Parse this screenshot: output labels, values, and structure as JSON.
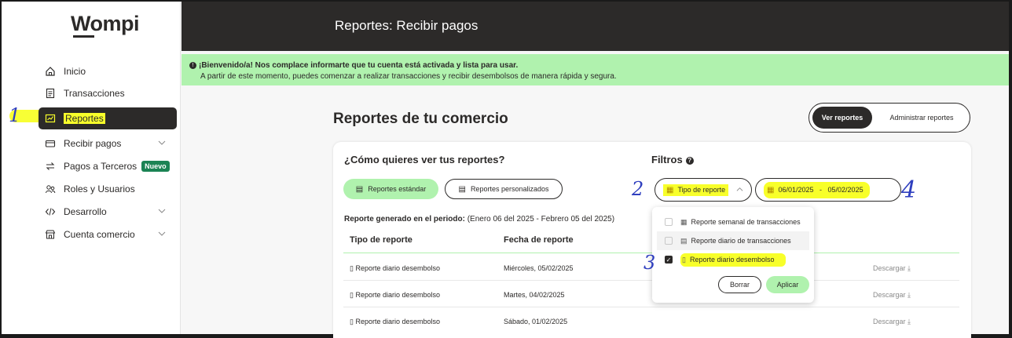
{
  "app": {
    "logo": "Wompi"
  },
  "sidebar": {
    "items": [
      {
        "label": "Inicio",
        "icon": "home-icon"
      },
      {
        "label": "Transacciones",
        "icon": "receipt-icon"
      },
      {
        "label": "Reportes",
        "icon": "report-icon",
        "active": true
      },
      {
        "label": "Recibir pagos",
        "icon": "card-icon",
        "expandable": true
      },
      {
        "label": "Pagos a Terceros",
        "icon": "transfer-icon",
        "badge": "Nuevo"
      },
      {
        "label": "Roles y Usuarios",
        "icon": "users-icon"
      },
      {
        "label": "Desarrollo",
        "icon": "code-icon",
        "expandable": true
      },
      {
        "label": "Cuenta comercio",
        "icon": "store-icon",
        "expandable": true
      }
    ]
  },
  "annotations": {
    "n1": "1",
    "n2": "2",
    "n3": "3",
    "n4": "4",
    "highlight_color": "#f8ff2a",
    "ink_color": "#2f3fbf"
  },
  "header": {
    "title": "Reportes: Recibir pagos"
  },
  "banner": {
    "line1": "¡Bienvenido/a! Nos complace informarte que tu cuenta está activada y lista para usar.",
    "line2": "A partir de este momento, puedes comenzar a realizar transacciones y recibir desembolsos de manera rápida y segura."
  },
  "main": {
    "title": "Reportes de tu comercio",
    "toggle": {
      "active": "Ver reportes",
      "inactive": "Administrar reportes"
    },
    "question": "¿Cómo quieres ver tus reportes?",
    "view_options": {
      "standard": "Reportes estándar",
      "custom": "Reportes personalizados"
    },
    "filters": {
      "title": "Filtros",
      "type_label": "Tipo de reporte",
      "date_from": "06/01/2025",
      "date_sep": "-",
      "date_to": "05/02/2025"
    },
    "period": {
      "label": "Reporte generado en el periodo:",
      "value": "(Enero 06 del 2025 - Febrero 05 del 2025)"
    },
    "table": {
      "headers": [
        "Tipo de reporte",
        "Fecha de reporte"
      ],
      "rows": [
        {
          "type": "Reporte diario desembolso",
          "date": "Miércoles, 05/02/2025",
          "action": "Descargar"
        },
        {
          "type": "Reporte diario desembolso",
          "date": "Martes, 04/02/2025",
          "action": "Descargar"
        },
        {
          "type": "Reporte diario desembolso",
          "date": "Sábado, 01/02/2025",
          "action": "Descargar"
        }
      ]
    },
    "dropdown": {
      "options": [
        {
          "label": "Reporte semanal de transacciones",
          "checked": false
        },
        {
          "label": "Reporte diario de transacciones",
          "checked": false
        },
        {
          "label": "Reporte diario desembolso",
          "checked": true
        }
      ],
      "clear": "Borrar",
      "apply": "Aplicar"
    }
  },
  "colors": {
    "dark": "#2c2a29",
    "accent_green": "#b0f2ae",
    "badge_green": "#1b8354"
  }
}
